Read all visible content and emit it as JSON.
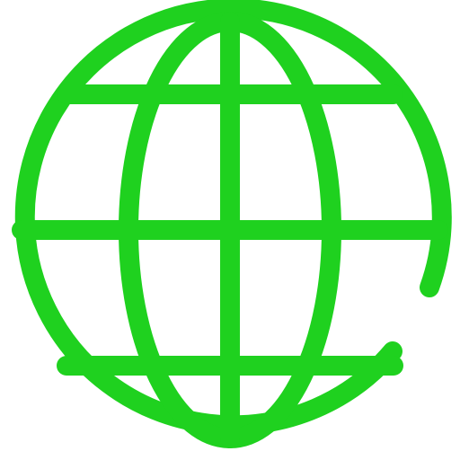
{
  "icon": {
    "name": "globe-icon",
    "color": "#1fd11f"
  }
}
